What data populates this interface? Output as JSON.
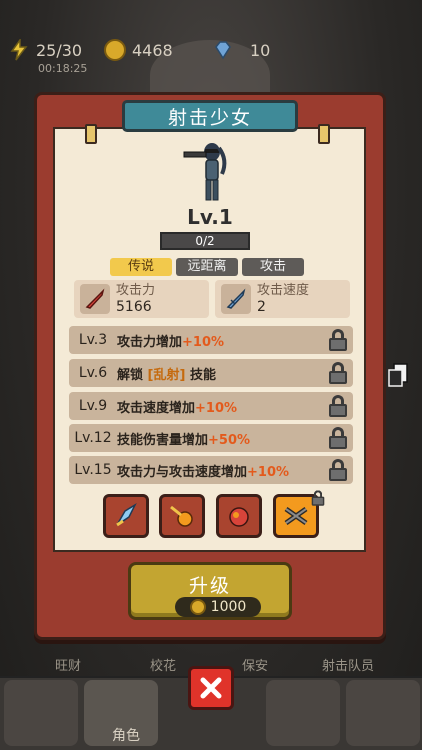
{
  "topbar": {
    "energy": "25/30",
    "energy_timer": "00:18:25",
    "coins": "4468",
    "gems": "10"
  },
  "modal": {
    "title": "射击少女",
    "level": "Lv.1",
    "xp": "0/2",
    "tags": [
      "传说",
      "远距离",
      "攻击"
    ],
    "stats": [
      {
        "label": "攻击力",
        "value": "5166",
        "icon": "red-sword-icon"
      },
      {
        "label": "攻击速度",
        "value": "2",
        "icon": "blue-sword-icon"
      }
    ],
    "perks": [
      {
        "level": "Lv.3",
        "text": "攻击力增加",
        "bonus": "+10%"
      },
      {
        "level": "Lv.6",
        "text_pre": "解锁",
        "highlight": "[乱射]",
        "text_post": "技能"
      },
      {
        "level": "Lv.9",
        "text": "攻击速度增加",
        "bonus": "+10%"
      },
      {
        "level": "Lv.12",
        "text": "技能伤害量增加",
        "bonus": "+50%"
      },
      {
        "level": "Lv.15",
        "text": "攻击力与攻击速度增加",
        "bonus": "+10%"
      }
    ],
    "skills": [
      "ice-shard-skill-icon",
      "fire-shot-skill-icon",
      "explosion-skill-icon",
      "crossed-guns-skill-icon"
    ],
    "upgrade": {
      "label": "升级",
      "cost": "1000"
    }
  },
  "bottom": {
    "labels": [
      "旺财",
      "校花",
      "保安",
      "射击队员"
    ],
    "role_tab": "角色"
  },
  "colors": {
    "modal_red": "#9b3c2f",
    "title_teal": "#3f8a98",
    "legend_gold": "#f2c94c",
    "bonus_orange": "#e35a1c",
    "upgrade_gold": "#c3a531",
    "close_red": "#e0332a"
  }
}
